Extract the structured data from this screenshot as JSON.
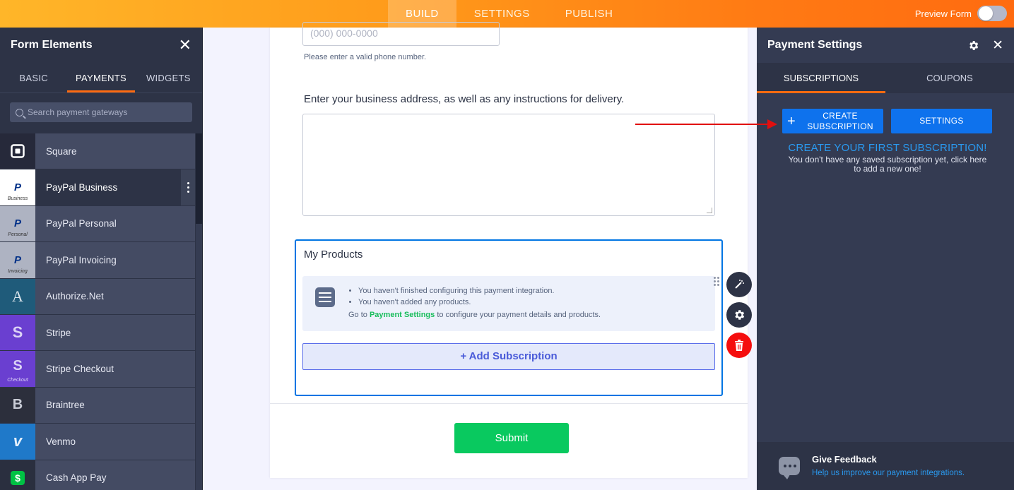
{
  "topbar": {
    "tabs": [
      "BUILD",
      "SETTINGS",
      "PUBLISH"
    ],
    "preview_label": "Preview Form"
  },
  "left_panel": {
    "title": "Form Elements",
    "tabs": [
      "BASIC",
      "PAYMENTS",
      "WIDGETS"
    ],
    "search_placeholder": "Search payment gateways",
    "gateways": [
      {
        "label": "Square",
        "icon": "square-icon"
      },
      {
        "label": "PayPal Business",
        "icon": "paypal-business-icon",
        "sub": "Business"
      },
      {
        "label": "PayPal Personal",
        "icon": "paypal-personal-icon",
        "sub": "Personal"
      },
      {
        "label": "PayPal Invoicing",
        "icon": "paypal-invoicing-icon",
        "sub": "Invoicing"
      },
      {
        "label": "Authorize.Net",
        "icon": "authorize-net-icon"
      },
      {
        "label": "Stripe",
        "icon": "stripe-icon"
      },
      {
        "label": "Stripe Checkout",
        "icon": "stripe-checkout-icon",
        "sub": "Checkout"
      },
      {
        "label": "Braintree",
        "icon": "braintree-icon"
      },
      {
        "label": "Venmo",
        "icon": "venmo-icon"
      },
      {
        "label": "Cash App Pay",
        "icon": "cash-app-icon"
      }
    ]
  },
  "form": {
    "phone_placeholder": "(000) 000-0000",
    "phone_hint": "Please enter a valid phone number.",
    "address_label": "Enter your business address, as well as any instructions for delivery.",
    "products": {
      "title": "My Products",
      "notice_items": [
        "You haven't finished configuring this payment integration.",
        "You haven't added any products."
      ],
      "go_prefix": "Go to ",
      "go_link": "Payment Settings",
      "go_suffix": " to configure your payment details and products.",
      "add_label": "+ Add Subscription"
    },
    "submit_label": "Submit"
  },
  "right_panel": {
    "title": "Payment Settings",
    "tabs": [
      "SUBSCRIPTIONS",
      "COUPONS"
    ],
    "create_label_1": "CREATE",
    "create_label_2": "SUBSCRIPTION",
    "settings_label": "SETTINGS",
    "empty_title": "CREATE YOUR FIRST SUBSCRIPTION!",
    "empty_desc": "You don't have any saved subscription yet, click here to add a new one!",
    "feedback_title": "Give Feedback",
    "feedback_link": "Help us improve our payment integrations."
  },
  "colors": {
    "accent_orange": "#ff6b10",
    "primary_blue": "#0e72ed",
    "submit_green": "#09c95f",
    "annotation_red": "#e10f0f"
  }
}
